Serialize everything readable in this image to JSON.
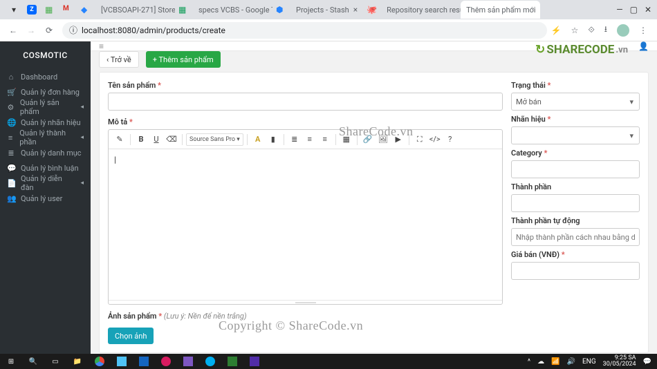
{
  "browser": {
    "tabs": [
      {
        "label": "[VCBSOAPI-271] Store"
      },
      {
        "label": "specs VCBS - Google T"
      },
      {
        "label": "Projects - Stash"
      },
      {
        "label": "Repository search resu"
      },
      {
        "label": "Thêm sản phẩm mới"
      }
    ],
    "url": "localhost:8080/admin/products/create"
  },
  "sidebar": {
    "brand": "COSMOTIC",
    "items": [
      {
        "label": "Dashboard",
        "expandable": false
      },
      {
        "label": "Quản lý đơn hàng",
        "expandable": false
      },
      {
        "label": "Quản lý sản phẩm",
        "expandable": true
      },
      {
        "label": "Quản lý nhãn hiệu",
        "expandable": false
      },
      {
        "label": "Quản lý thành phần",
        "expandable": true
      },
      {
        "label": "Quản lý danh mục",
        "expandable": false
      },
      {
        "label": "Quản lý bình luận",
        "expandable": false
      },
      {
        "label": "Quản lý diễn đàn",
        "expandable": true
      },
      {
        "label": "Quản lý user",
        "expandable": false
      }
    ]
  },
  "actions": {
    "back": "‹ Trở về",
    "add": "+ Thêm sản phẩm"
  },
  "form": {
    "name_label": "Tên sản phẩm",
    "desc_label": "Mô tả",
    "image_label": "Ảnh sản phẩm",
    "image_hint": "(Lưu ý: Nền để nền trắng)",
    "choose_image": "Chọn ảnh",
    "editor_font": "Source Sans Pro ▾"
  },
  "side_form": {
    "status_label": "Trạng thái",
    "status_value": "Mở bán",
    "brand_label": "Nhãn hiệu",
    "category_label": "Category",
    "ingredient_label": "Thành phần",
    "auto_ingredient_label": "Thành phần tự động",
    "auto_ingredient_placeholder": "Nhập thành phần cách nhau bằng dấu ,",
    "price_label": "Giá bán (VNĐ)"
  },
  "watermark": {
    "logo_main": "SHARECODE",
    "logo_suffix": ".vn",
    "center1": "ShareCode.vn",
    "center2": "Copyright © ShareCode.vn"
  },
  "taskbar": {
    "lang": "ENG",
    "time": "9:25 SA",
    "date": "30/05/2024"
  }
}
